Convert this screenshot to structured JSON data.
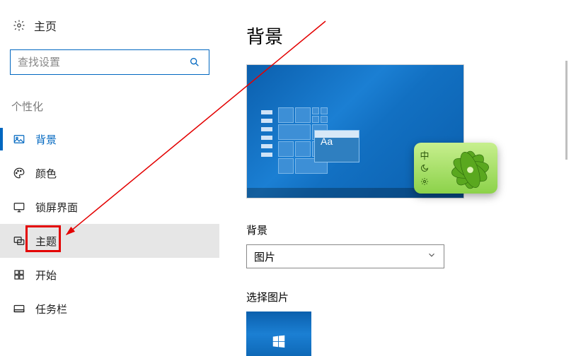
{
  "sidebar": {
    "home_label": "主页",
    "search_placeholder": "查找设置",
    "section_label": "个性化",
    "items": [
      {
        "label": "背景"
      },
      {
        "label": "颜色"
      },
      {
        "label": "锁屏界面"
      },
      {
        "label": "主题"
      },
      {
        "label": "开始"
      },
      {
        "label": "任务栏"
      }
    ]
  },
  "main": {
    "title": "背景",
    "preview_sample_text": "Aa",
    "background_label": "背景",
    "background_select_value": "图片",
    "choose_picture_label": "选择图片"
  },
  "ime": {
    "mode_char": "中"
  }
}
